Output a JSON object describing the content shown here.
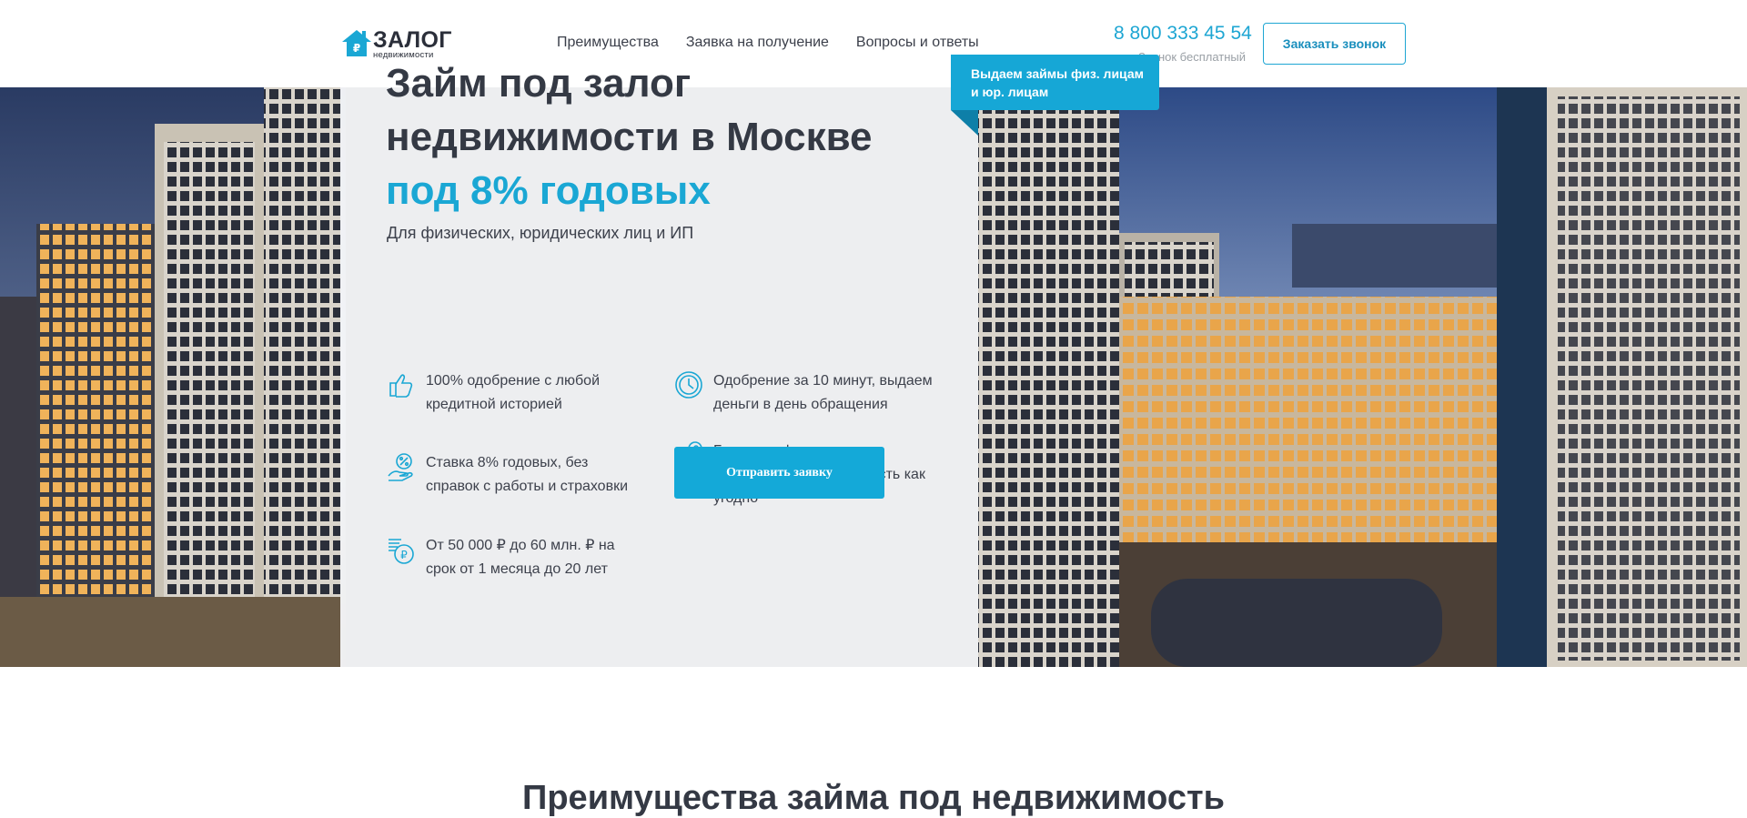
{
  "header": {
    "logo": {
      "main": "ЗАЛОГ",
      "sub": "недвижимости"
    },
    "nav": [
      {
        "label": "Преимущества"
      },
      {
        "label": "Заявка на получение"
      },
      {
        "label": "Вопросы и ответы"
      }
    ],
    "phone": {
      "number": "8 800 333 45 54",
      "note": "Звонок бесплатный"
    },
    "call_button": "Заказать звонок"
  },
  "hero": {
    "title_line1": "Займ под залог",
    "title_line2": "недвижимости в Москве",
    "title_accent": "под 8% годовых",
    "subtitle": "Для физических, юридических лиц и ИП",
    "ribbon_line1": "Выдаем займы физ. лицам",
    "ribbon_line2": "и юр. лицам",
    "features": [
      {
        "icon": "thumbs-up-icon",
        "line1": "100% одобрение с любой",
        "line2": "кредитной историей"
      },
      {
        "icon": "clock-icon",
        "line1": "Одобрение за 10 минут, выдаем",
        "line2": "деньги в день обращения"
      },
      {
        "icon": "percent-hand-icon",
        "line1": "Ставка 8% годовых, без",
        "line2": "справок с работы и страховки"
      },
      {
        "icon": "key-icon",
        "line1": "Без переоформления:",
        "line2": "используйте собственность как",
        "line3": "угодно"
      },
      {
        "icon": "ruble-coins-icon",
        "line1": "От 50 000 ₽ до 60 млн. ₽ на",
        "line2": "срок от 1 месяца до 20 лет"
      }
    ],
    "apply_button": "Отправить заявку"
  },
  "section": {
    "title": "Преимущества займа под недвижимость"
  },
  "colors": {
    "accent": "#1aa7d4",
    "text": "#343944",
    "ribbon_fold": "#0e7fa8"
  }
}
